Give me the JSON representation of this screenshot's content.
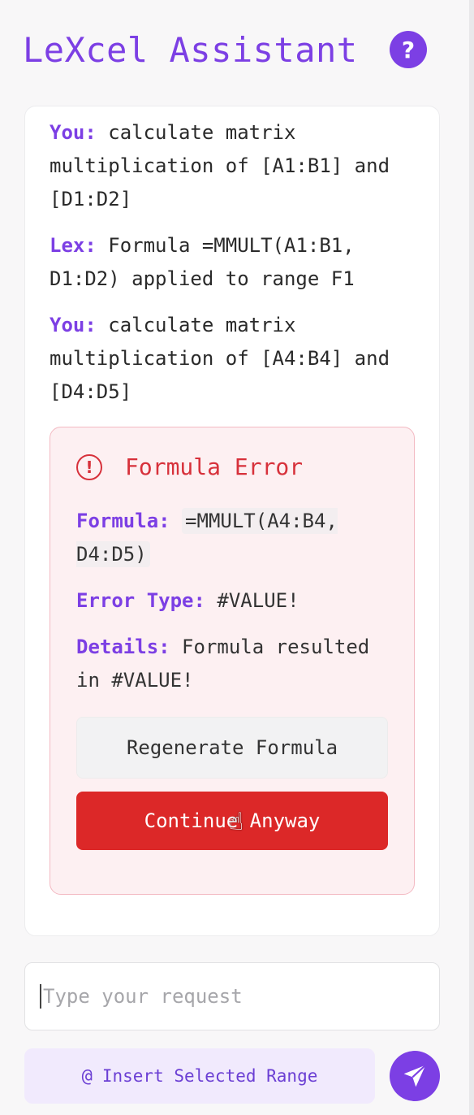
{
  "header": {
    "title": "LeXcel Assistant",
    "help_icon": "?"
  },
  "chat": {
    "messages": [
      {
        "who": "You:",
        "text": "calculate matrix multiplication of [A1:B1] and [D1:D2]"
      },
      {
        "who": "Lex:",
        "text": "Formula =MMULT(A1:B1, D1:D2) applied to range F1"
      },
      {
        "who": "You:",
        "text": "calculate matrix multiplication of [A4:B4] and [D4:D5]"
      }
    ]
  },
  "error_card": {
    "icon": "!",
    "title": "Formula Error",
    "formula_label": "Formula:",
    "formula_value": "=MMULT(A4:B4, D4:D5)",
    "type_label": "Error Type:",
    "type_value": "#VALUE!",
    "details_label": "Details:",
    "details_value": "Formula resulted in #VALUE!",
    "regenerate_label": "Regenerate Formula",
    "continue_label": "Continue Anyway"
  },
  "input": {
    "placeholder": "Type your request"
  },
  "actions": {
    "insert_icon": "@",
    "insert_label": "Insert Selected Range"
  },
  "colors": {
    "accent": "#7c3fe4",
    "error": "#d7313b",
    "danger_button": "#dc2828"
  }
}
